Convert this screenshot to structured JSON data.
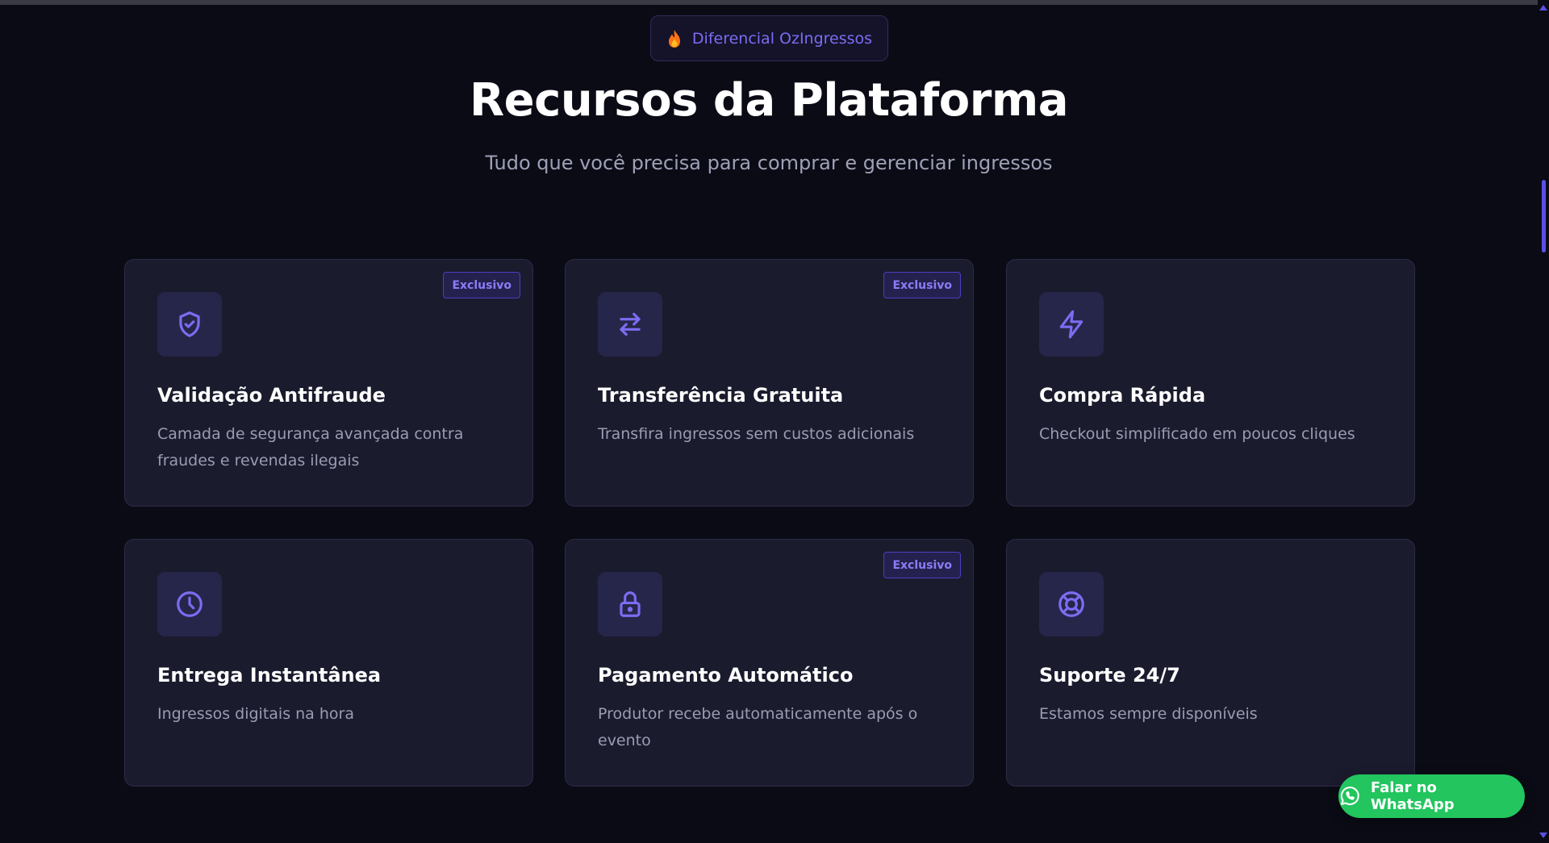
{
  "header": {
    "badge_label": "Diferencial OzIngressos",
    "badge_icon": "fire-icon",
    "title": "Recursos da Plataforma",
    "subtitle": "Tudo que você precisa para comprar e gerenciar ingressos"
  },
  "colors": {
    "background": "#0b0b16",
    "card": "#1b1b2e",
    "accent": "#7c6cf2",
    "whatsapp": "#22c55e"
  },
  "features": [
    {
      "title": "Validação Antifraude",
      "description": "Camada de segurança avançada contra fraudes e revendas ilegais",
      "icon": "shield-check-icon",
      "tag": "Exclusivo"
    },
    {
      "title": "Transferência Gratuita",
      "description": "Transfira ingressos sem custos adicionais",
      "icon": "arrows-exchange-icon",
      "tag": "Exclusivo"
    },
    {
      "title": "Compra Rápida",
      "description": "Checkout simplificado em poucos cliques",
      "icon": "lightning-icon"
    },
    {
      "title": "Entrega Instantânea",
      "description": "Ingressos digitais na hora",
      "icon": "clock-icon"
    },
    {
      "title": "Pagamento Automático",
      "description": "Produtor recebe automaticamente após o evento",
      "icon": "lock-icon",
      "tag": "Exclusivo"
    },
    {
      "title": "Suporte 24/7",
      "description": "Estamos sempre disponíveis",
      "icon": "lifebuoy-icon"
    }
  ],
  "whatsapp_button": {
    "label": "Falar no WhatsApp",
    "icon": "whatsapp-icon"
  }
}
